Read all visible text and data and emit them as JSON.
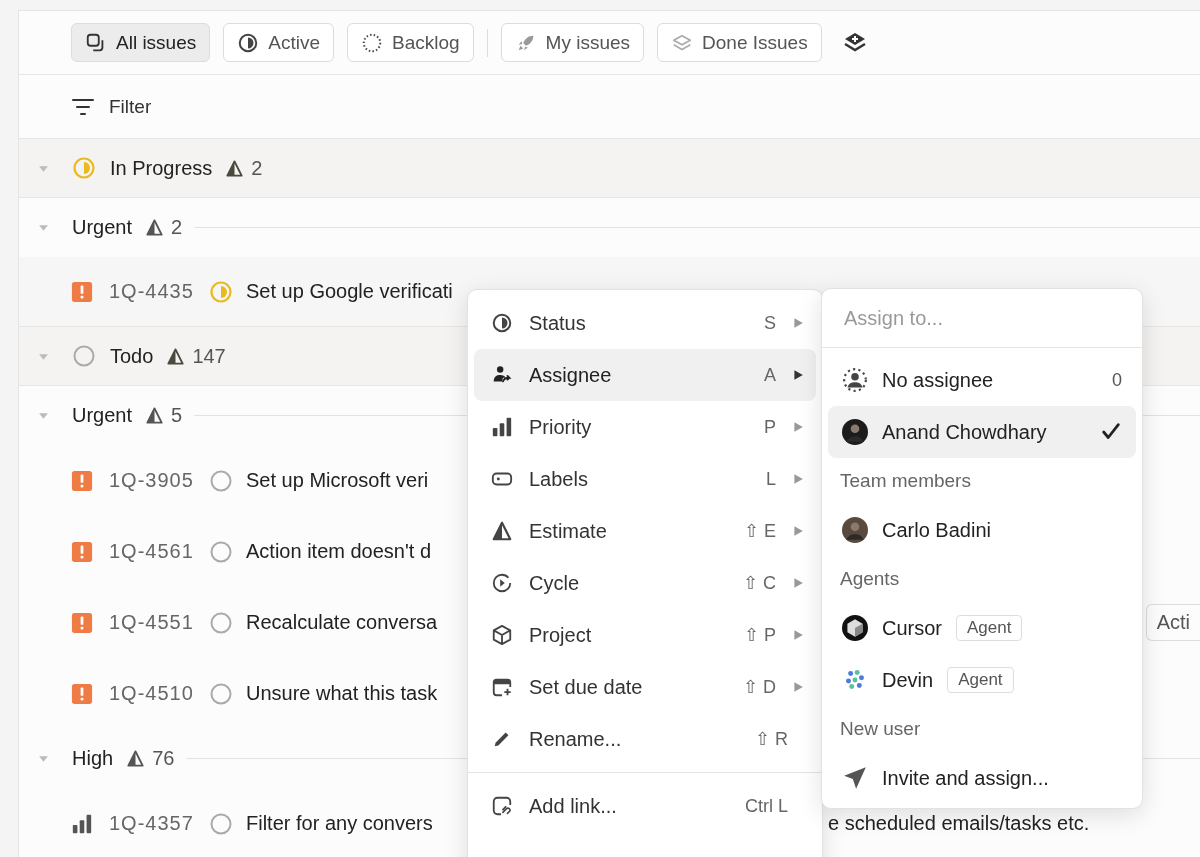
{
  "views": [
    {
      "kind": "all",
      "label": "All issues",
      "selected": true
    },
    {
      "kind": "active",
      "label": "Active",
      "selected": false
    },
    {
      "kind": "backlog",
      "label": "Backlog",
      "selected": false
    },
    {
      "kind": "mine",
      "label": "My issues",
      "selected": false
    },
    {
      "kind": "done",
      "label": "Done Issues",
      "selected": false
    }
  ],
  "filter": {
    "label": "Filter"
  },
  "list_rows": [
    {
      "kind": "group",
      "status": {
        "kind": "in_progress"
      },
      "label": "In Progress",
      "count": "2"
    },
    {
      "kind": "priority",
      "label": "Urgent",
      "count": "2"
    },
    {
      "kind": "issue",
      "priority": {
        "kind": "urgent"
      },
      "id": "1Q-4435",
      "status": {
        "kind": "in_progress"
      },
      "title": "Set up Google verificati",
      "hovered": true
    },
    {
      "kind": "group",
      "status": {
        "kind": "todo"
      },
      "label": "Todo",
      "count": "147"
    },
    {
      "kind": "priority",
      "label": "Urgent",
      "count": "5"
    },
    {
      "kind": "issue",
      "priority": {
        "kind": "urgent"
      },
      "id": "1Q-3905",
      "status": {
        "kind": "todo"
      },
      "title": "Set up Microsoft veri",
      "hovered": false
    },
    {
      "kind": "issue",
      "priority": {
        "kind": "urgent"
      },
      "id": "1Q-4561",
      "status": {
        "kind": "todo"
      },
      "title": "Action item doesn't d",
      "hovered": false
    },
    {
      "kind": "issue",
      "priority": {
        "kind": "urgent"
      },
      "id": "1Q-4551",
      "status": {
        "kind": "todo"
      },
      "title": "Recalculate conversa",
      "label_chip": "Acti",
      "hovered": false
    },
    {
      "kind": "issue",
      "priority": {
        "kind": "urgent"
      },
      "id": "1Q-4510",
      "status": {
        "kind": "todo"
      },
      "title": "Unsure what this task",
      "hovered": false
    },
    {
      "kind": "priority",
      "label": "High",
      "count": "76"
    },
    {
      "kind": "issue",
      "priority": {
        "kind": "high"
      },
      "id": "1Q-4357",
      "status": {
        "kind": "todo"
      },
      "title": "Filter for any convers",
      "title_tail": "e scheduled emails/tasks etc.",
      "hovered": false
    }
  ],
  "context_menu": {
    "sections": [
      [
        {
          "kind": "status",
          "label": "Status",
          "shortcut": "S",
          "submenu": true,
          "highlighted": false
        },
        {
          "kind": "assignee",
          "label": "Assignee",
          "shortcut": "A",
          "submenu": true,
          "highlighted": true
        },
        {
          "kind": "priority",
          "label": "Priority",
          "shortcut": "P",
          "submenu": true,
          "highlighted": false
        },
        {
          "kind": "labels",
          "label": "Labels",
          "shortcut": "L",
          "submenu": true,
          "highlighted": false
        },
        {
          "kind": "estimate",
          "label": "Estimate",
          "shortcut": "⇧ E",
          "submenu": true,
          "highlighted": false
        },
        {
          "kind": "cycle",
          "label": "Cycle",
          "shortcut": "⇧ C",
          "submenu": true,
          "highlighted": false
        },
        {
          "kind": "project",
          "label": "Project",
          "shortcut": "⇧ P",
          "submenu": true,
          "highlighted": false
        },
        {
          "kind": "due",
          "label": "Set due date",
          "shortcut": "⇧ D",
          "submenu": true,
          "highlighted": false
        },
        {
          "kind": "rename",
          "label": "Rename...",
          "shortcut": "⇧ R",
          "submenu": false,
          "highlighted": false
        }
      ],
      [
        {
          "kind": "link",
          "label": "Add link...",
          "shortcut": "Ctrl L",
          "submenu": false,
          "highlighted": false
        }
      ]
    ]
  },
  "assign_menu": {
    "placeholder": "Assign to...",
    "items": [
      {
        "kind": "none",
        "label": "No assignee",
        "count": "0",
        "selected": false
      },
      {
        "kind": "person",
        "label": "Anand Chowdhary",
        "selected": true
      },
      {
        "kind": "heading",
        "label": "Team members"
      },
      {
        "kind": "person",
        "label": "Carlo Badini",
        "selected": false
      },
      {
        "kind": "heading",
        "label": "Agents"
      },
      {
        "kind": "cursor",
        "label": "Cursor",
        "tag": "Agent",
        "selected": false
      },
      {
        "kind": "devin",
        "label": "Devin",
        "tag": "Agent",
        "selected": false
      },
      {
        "kind": "heading",
        "label": "New user"
      },
      {
        "kind": "invite",
        "label": "Invite and assign...",
        "selected": false
      }
    ]
  }
}
